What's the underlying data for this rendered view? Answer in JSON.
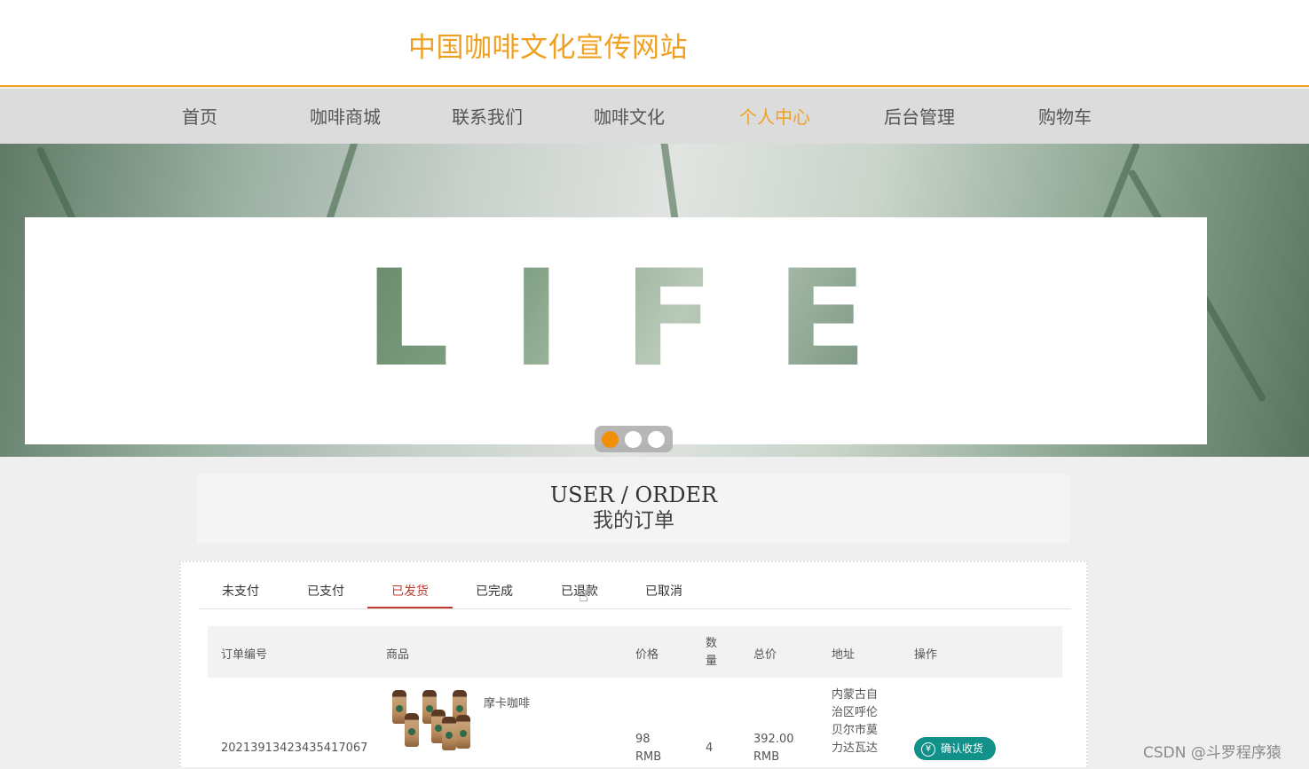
{
  "header": {
    "title": "中国咖啡文化宣传网站"
  },
  "nav": {
    "items": [
      {
        "label": "首页"
      },
      {
        "label": "咖啡商城"
      },
      {
        "label": "联系我们"
      },
      {
        "label": "咖啡文化"
      },
      {
        "label": "个人中心"
      },
      {
        "label": "后台管理"
      },
      {
        "label": "购物车"
      }
    ],
    "active_label": "个人中心",
    "active_color": "#f0a020"
  },
  "banner": {
    "text": "LIFE",
    "slides": 3,
    "active_slide": 1,
    "active_dot_color": "#f0900a"
  },
  "section": {
    "title_en": "USER / ORDER",
    "title_cn": "我的订单"
  },
  "orders": {
    "tabs": [
      {
        "label": "未支付"
      },
      {
        "label": "已支付"
      },
      {
        "label": "已发货"
      },
      {
        "label": "已完成"
      },
      {
        "label": "已退款"
      },
      {
        "label": "已取消"
      }
    ],
    "active_tab": "已发货",
    "active_tab_color": "#c0392b",
    "columns": {
      "order_no": "订单编号",
      "product": "商品",
      "price": "价格",
      "qty": "数量",
      "total": "总价",
      "address": "地址",
      "action": "操作"
    },
    "rows": [
      {
        "order_no": "20213913423435417067",
        "product_name": "摩卡咖啡",
        "product_image": "coffee-bottles-thumbnail",
        "price": "98",
        "price_unit": "RMB",
        "qty": "4",
        "total": "392.00",
        "total_unit": "RMB",
        "address_lines": [
          "内蒙古自",
          "治区呼伦",
          "贝尔市莫",
          "力达瓦达"
        ],
        "action_label": "确认收货",
        "action_icon": "yen-icon",
        "action_color": "#12918a"
      }
    ]
  },
  "watermark": "CSDN @斗罗程序猿"
}
